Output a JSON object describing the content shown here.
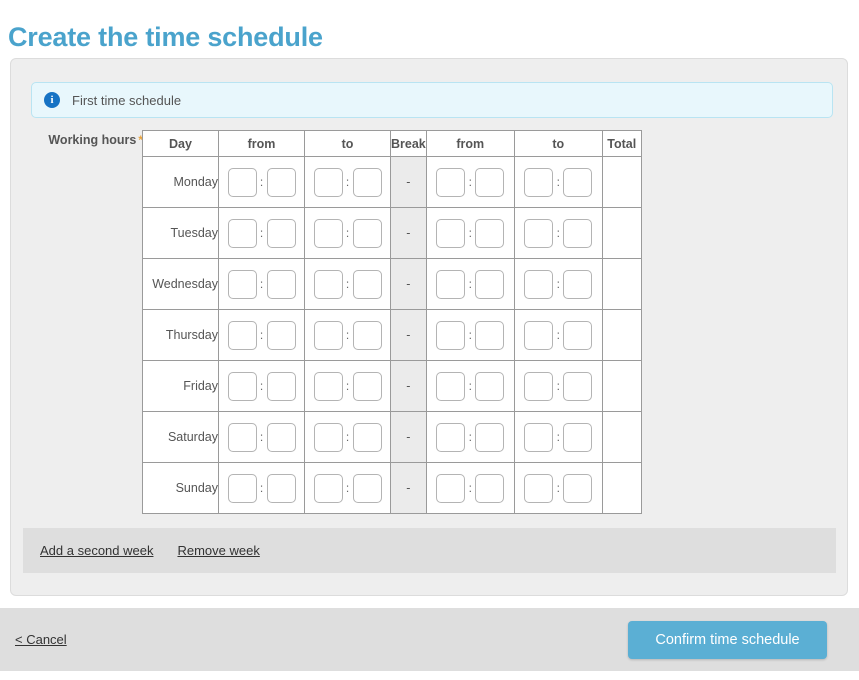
{
  "page": {
    "title": "Create the time schedule"
  },
  "info_banner": {
    "icon": "info-circle-icon",
    "text": "First time schedule"
  },
  "form": {
    "working_hours_label": "Working hours",
    "required_marker": "*"
  },
  "table": {
    "headers": {
      "day": "Day",
      "from1": "from",
      "to1": "to",
      "break": "Break",
      "from2": "from",
      "to2": "to",
      "total": "Total"
    },
    "break_value": "-",
    "time_placeholder": "",
    "colon": ":",
    "rows": [
      {
        "day": "Monday",
        "from1_h": "",
        "from1_m": "",
        "to1_h": "",
        "to1_m": "",
        "break": "-",
        "from2_h": "",
        "from2_m": "",
        "to2_h": "",
        "to2_m": "",
        "total": ""
      },
      {
        "day": "Tuesday",
        "from1_h": "",
        "from1_m": "",
        "to1_h": "",
        "to1_m": "",
        "break": "-",
        "from2_h": "",
        "from2_m": "",
        "to2_h": "",
        "to2_m": "",
        "total": ""
      },
      {
        "day": "Wednesday",
        "from1_h": "",
        "from1_m": "",
        "to1_h": "",
        "to1_m": "",
        "break": "-",
        "from2_h": "",
        "from2_m": "",
        "to2_h": "",
        "to2_m": "",
        "total": ""
      },
      {
        "day": "Thursday",
        "from1_h": "",
        "from1_m": "",
        "to1_h": "",
        "to1_m": "",
        "break": "-",
        "from2_h": "",
        "from2_m": "",
        "to2_h": "",
        "to2_m": "",
        "total": ""
      },
      {
        "day": "Friday",
        "from1_h": "",
        "from1_m": "",
        "to1_h": "",
        "to1_m": "",
        "break": "-",
        "from2_h": "",
        "from2_m": "",
        "to2_h": "",
        "to2_m": "",
        "total": ""
      },
      {
        "day": "Saturday",
        "from1_h": "",
        "from1_m": "",
        "to1_h": "",
        "to1_m": "",
        "break": "-",
        "from2_h": "",
        "from2_m": "",
        "to2_h": "",
        "to2_m": "",
        "total": ""
      },
      {
        "day": "Sunday",
        "from1_h": "",
        "from1_m": "",
        "to1_h": "",
        "to1_m": "",
        "break": "-",
        "from2_h": "",
        "from2_m": "",
        "to2_h": "",
        "to2_m": "",
        "total": ""
      }
    ]
  },
  "week_actions": {
    "add_week": "Add a second week",
    "remove_week": "Remove week"
  },
  "footer": {
    "cancel": "< Cancel",
    "confirm": "Confirm time schedule"
  },
  "colors": {
    "title_blue": "#4aa3cc",
    "button_blue": "#5bafd4",
    "info_bg": "#e8f7fc",
    "info_border": "#b9e4f2",
    "panel_bg": "#eeeeee",
    "bar_gray": "#dedede",
    "required_orange": "#e8a33d"
  }
}
